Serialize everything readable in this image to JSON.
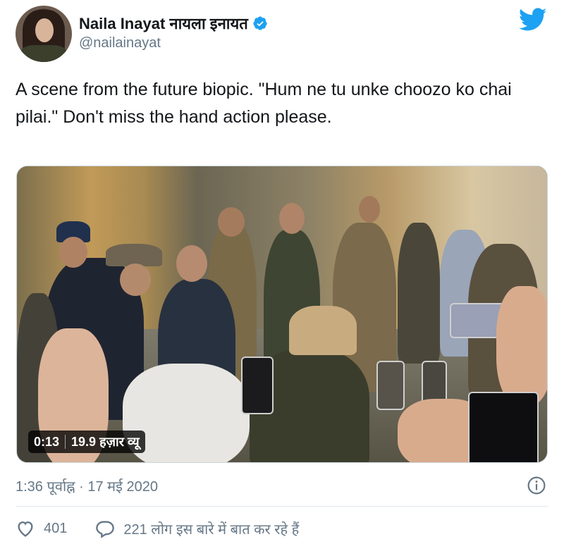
{
  "author": {
    "display_name": "Naila Inayat नायला इनायत",
    "handle": "@nailainayat",
    "verified_icon": "verified-badge-icon",
    "avatar_icon": "avatar"
  },
  "brand": {
    "logo_icon": "twitter-bird-icon",
    "color": "#1da1f2"
  },
  "tweet": {
    "text": "A scene from the future biopic. \"Hum ne tu unke choozo ko chai pilai.\" Don't miss the hand action please."
  },
  "video": {
    "duration": "0:13",
    "views": "19.9 हज़ार व्यू"
  },
  "footer": {
    "timestamp": "1:36 पूर्वाह्न · 17 मई 2020",
    "info_icon": "info-icon"
  },
  "actions": {
    "likes": "401",
    "replies_text": "221 लोग इस बारे में बात कर रहे हैं",
    "like_icon": "heart-icon",
    "reply_icon": "comment-icon"
  },
  "colors": {
    "text": "#14171a",
    "secondary": "#657786",
    "divider": "#e1e8ed"
  }
}
